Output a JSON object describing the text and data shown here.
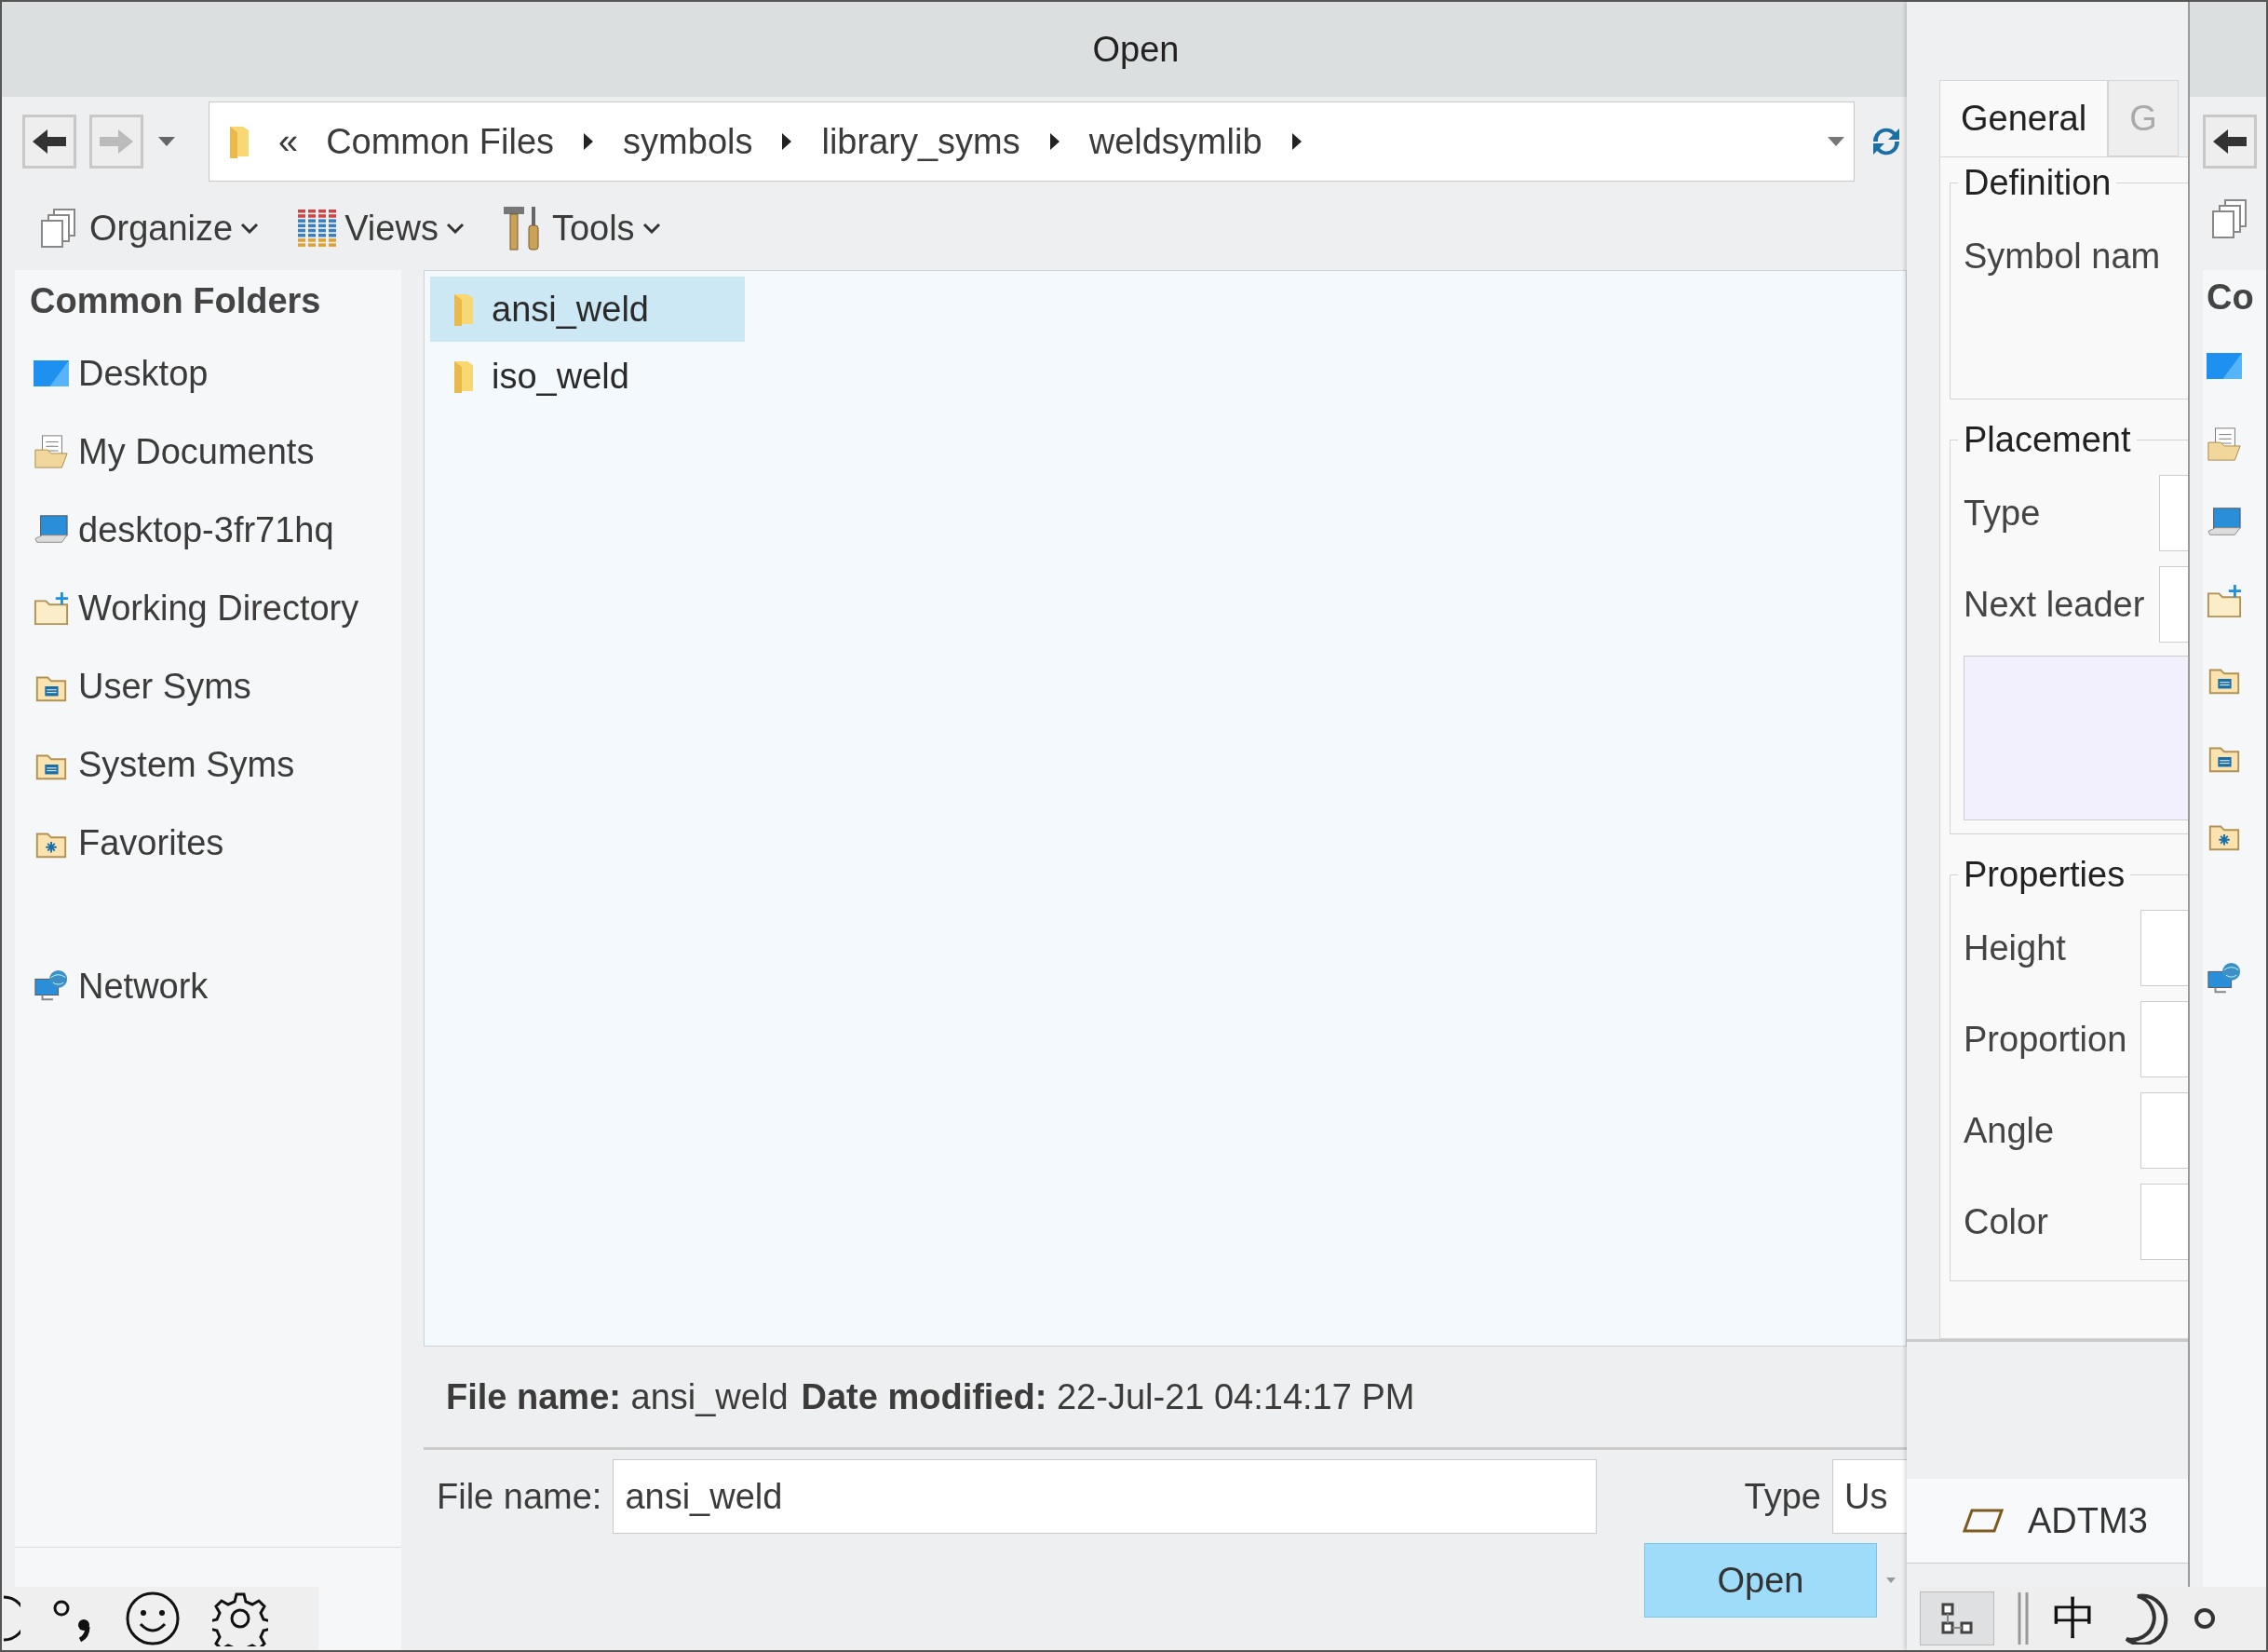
{
  "window": {
    "title": "Open"
  },
  "address": {
    "overflow": "«",
    "path": [
      "Common Files",
      "symbols",
      "library_syms",
      "weldsymlib"
    ]
  },
  "toolbar": [
    {
      "label": "Organize",
      "kind": "organize"
    },
    {
      "label": "Views",
      "kind": "views"
    },
    {
      "label": "Tools",
      "kind": "tools"
    }
  ],
  "sidebar": {
    "heading": "Common Folders",
    "items": [
      {
        "label": "Desktop",
        "kind": "desktop"
      },
      {
        "label": "My Documents",
        "kind": "documents"
      },
      {
        "label": "desktop-3fr71hq",
        "kind": "computer"
      },
      {
        "label": "Working Directory",
        "kind": "working"
      },
      {
        "label": "User Syms",
        "kind": "syms"
      },
      {
        "label": "System Syms",
        "kind": "syms"
      },
      {
        "label": "Favorites",
        "kind": "favorites"
      },
      {
        "label": "Network",
        "kind": "network"
      }
    ]
  },
  "files": [
    {
      "name": "ansi_weld",
      "selected": true
    },
    {
      "name": "iso_weld",
      "selected": false
    }
  ],
  "details": {
    "name_label": "File name:",
    "name_value": "ansi_weld",
    "date_label": "Date modified:",
    "date_value": "22-Jul-21 04:14:17 PM"
  },
  "file_name_field": {
    "label": "File name:",
    "value": "ansi_weld"
  },
  "type_field": {
    "label": "Type",
    "value": "Us"
  },
  "open_button": "Open",
  "side_panel": {
    "tabs": [
      {
        "label": "General",
        "selected": true
      },
      {
        "label": "G",
        "selected": false
      }
    ],
    "definition": {
      "title": "Definition",
      "label": "Symbol nam"
    },
    "placement": {
      "title": "Placement",
      "fields": [
        "Type",
        "Next leader"
      ]
    },
    "properties": {
      "title": "Properties",
      "fields": [
        "Height",
        "Proportion",
        "Angle",
        "Color"
      ]
    },
    "model": "ADTM3"
  },
  "back_window": {
    "heading": "Co"
  },
  "ime": {
    "mode": "中"
  }
}
